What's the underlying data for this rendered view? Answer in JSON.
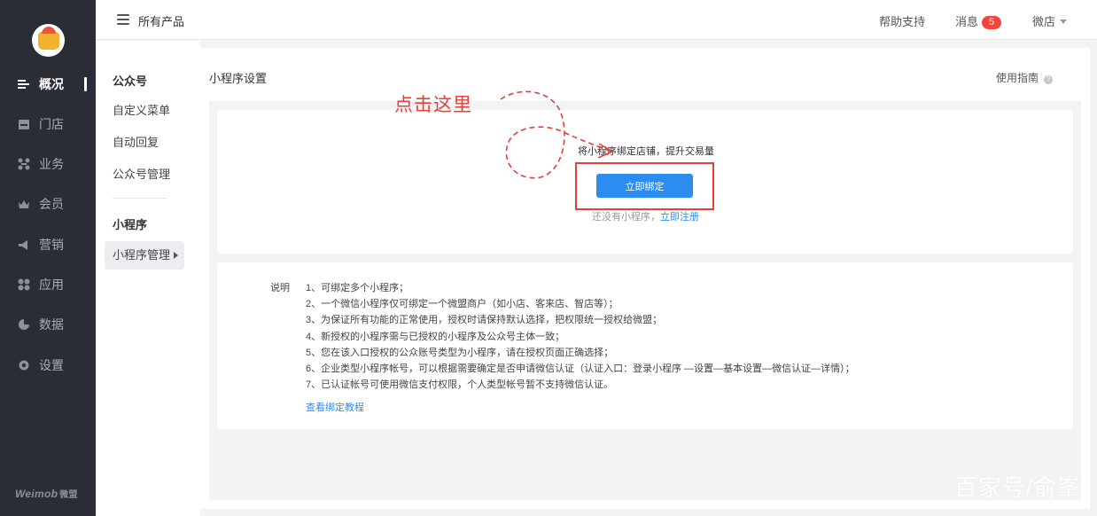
{
  "nav": {
    "items": [
      {
        "label": "概况",
        "icon": "overview-icon",
        "active": true
      },
      {
        "label": "门店",
        "icon": "store-icon",
        "active": false
      },
      {
        "label": "业务",
        "icon": "business-icon",
        "active": false
      },
      {
        "label": "会员",
        "icon": "crown-icon",
        "active": false
      },
      {
        "label": "营销",
        "icon": "megaphone-icon",
        "active": false
      },
      {
        "label": "应用",
        "icon": "apps-icon",
        "active": false
      },
      {
        "label": "数据",
        "icon": "pie-chart-icon",
        "active": false
      },
      {
        "label": "设置",
        "icon": "gear-icon",
        "active": false
      }
    ],
    "brand": "Weimob",
    "brand_cn": "微盟"
  },
  "topbar": {
    "all_products": "所有产品",
    "help": "帮助支持",
    "messages": "消息",
    "message_count": "5",
    "store": "微店"
  },
  "subnav": {
    "group1": "公众号",
    "group1_items": [
      "自定义菜单",
      "自动回复",
      "公众号管理"
    ],
    "group2": "小程序",
    "group2_items": [
      "小程序管理"
    ]
  },
  "main": {
    "title": "小程序设置",
    "guide": "使用指南",
    "bind_hint": "将小程序绑定店铺，提升交易量",
    "bind_button": "立即绑定",
    "no_app_text": "还没有小程序，",
    "register_link": "立即注册",
    "notes_label": "说明",
    "notes": [
      "1、可绑定多个小程序；",
      "2、一个微信小程序仅可绑定一个微盟商户（如小店、客来店、智店等）；",
      "3、为保证所有功能的正常使用，授权时请保持默认选择，把权限统一授权给微盟；",
      "4、新授权的小程序需与已授权的小程序及公众号主体一致；",
      "5、您在该入口授权的公众账号类型为小程序，请在授权页面正确选择；",
      "6、企业类型小程序帐号，可以根据需要确定是否申请微信认证（认证入口：登录小程序 —设置—基本设置—微信认证—详情）；",
      "7、已认证帐号可使用微信支付权限，个人类型帐号暂不支持微信认证。"
    ],
    "tutorial_link": "查看绑定教程"
  },
  "annotation": {
    "text": "点击这里",
    "color": "#e6403a"
  },
  "watermark": "百家号/俞峯",
  "colors": {
    "sidebar": "#2a2d36",
    "primary": "#2d8cf0",
    "badge": "#f2453d"
  }
}
